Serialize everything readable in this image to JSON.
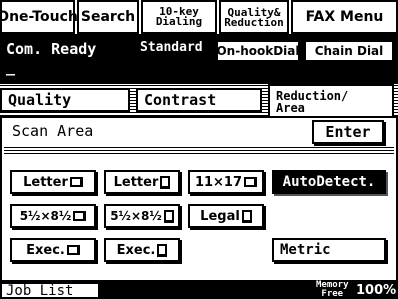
{
  "tabs": [
    {
      "label": "One-Touch"
    },
    {
      "label": "Search"
    },
    {
      "line1": "10-key",
      "line2": "Dialing"
    },
    {
      "line1": "Quality&",
      "line2": "Reduction"
    },
    {
      "label": "FAX Menu"
    }
  ],
  "status": {
    "state": "Com. Ready",
    "mode": "Standard",
    "onhook_label": "On-hookDial",
    "chain_label": "Chain Dial",
    "cursor": "_"
  },
  "subtabs": {
    "quality": "Quality",
    "contrast": "Contrast",
    "reduction_line1": "Reduction/",
    "reduction_line2": "Area"
  },
  "panel": {
    "title": "Scan Area",
    "enter_label": "Enter"
  },
  "sizes": {
    "letter_l": "Letter",
    "letter_p": "Letter",
    "ledger": "11×17",
    "auto": "AutoDetect.",
    "statement_l": "5½×8½",
    "statement_p": "5½×8½",
    "legal": "Legal",
    "exec_l": "Exec.",
    "exec_p": "Exec.",
    "metric": "Metric"
  },
  "footer": {
    "job_list": "Job List",
    "memory_line1": "Memory",
    "memory_line2": "Free",
    "memory_value": "100%"
  }
}
